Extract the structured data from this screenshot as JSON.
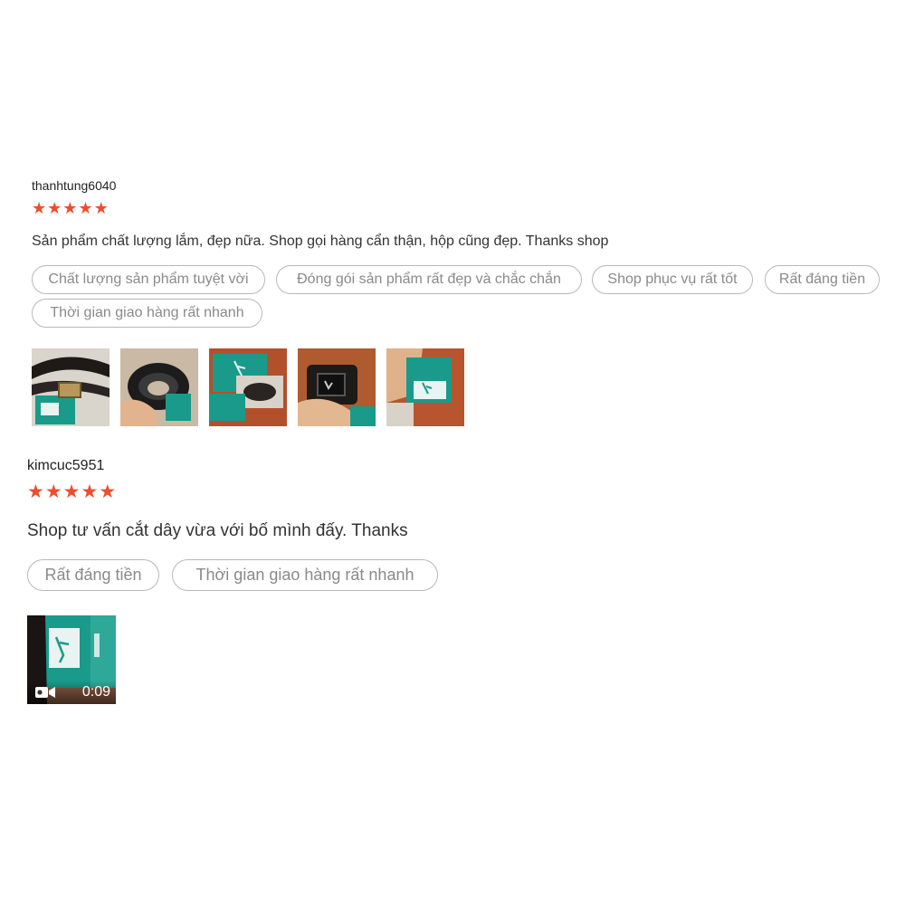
{
  "reviews": [
    {
      "username": "thanhtung6040",
      "rating": 5,
      "comment": "Sản phẩm chất lượng lắm, đẹp nữa. Shop gọi hàng cẩn thận, hộp cũng đẹp. Thanks shop",
      "tags": [
        "Chất lượng sản phẩm tuyệt vời",
        "Đóng gói sản phẩm rất đẹp và chắc chắn",
        "Shop phục vụ rất tốt",
        "Rất đáng tiền",
        "Thời gian giao hàng rất nhanh"
      ],
      "media": [
        "belt-photo",
        "belt-photo",
        "box-photo",
        "buckle-photo",
        "box-photo"
      ]
    },
    {
      "username": "kimcuc5951",
      "rating": 5,
      "comment": "Shop tư vấn cắt dây vừa với bố mình đấy. Thanks",
      "tags": [
        "Rất đáng tiền",
        "Thời gian giao hàng rất nhanh"
      ],
      "video": {
        "duration": "0:09",
        "icon": "video-camera-icon"
      }
    }
  ],
  "colors": {
    "star": "#ee4d2d",
    "tag_border": "#b8b8b8",
    "tag_text": "#8a8a8a",
    "box_teal": "#1a9a8a"
  }
}
